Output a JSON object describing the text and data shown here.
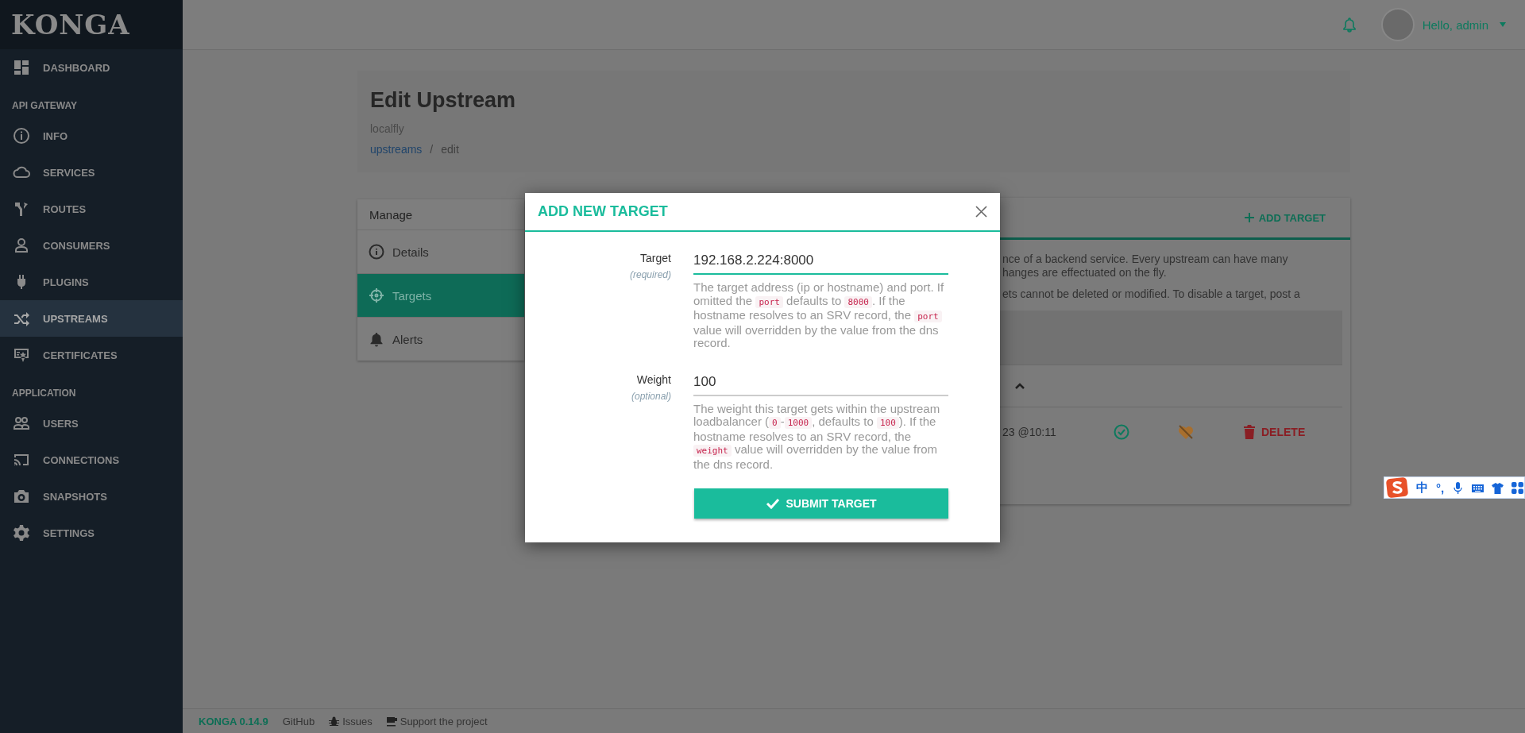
{
  "sidebar": {
    "logo": "KONGA",
    "groups": [
      {
        "items": [
          {
            "label": "DASHBOARD",
            "selected": false
          }
        ]
      },
      {
        "heading": "API GATEWAY",
        "items": [
          {
            "label": "INFO",
            "selected": false
          },
          {
            "label": "SERVICES",
            "selected": false
          },
          {
            "label": "ROUTES",
            "selected": false
          },
          {
            "label": "CONSUMERS",
            "selected": false
          },
          {
            "label": "PLUGINS",
            "selected": false
          },
          {
            "label": "UPSTREAMS",
            "selected": true
          },
          {
            "label": "CERTIFICATES",
            "selected": false
          }
        ]
      },
      {
        "heading": "APPLICATION",
        "items": [
          {
            "label": "USERS",
            "selected": false
          },
          {
            "label": "CONNECTIONS",
            "selected": false
          },
          {
            "label": "SNAPSHOTS",
            "selected": false
          },
          {
            "label": "SETTINGS",
            "selected": false
          }
        ]
      }
    ]
  },
  "topbar": {
    "greeting": "Hello, admin"
  },
  "page_header": {
    "title": "Edit Upstream",
    "subtitle": "localfly",
    "separator": "/",
    "breadcrumb": [
      {
        "label": "upstreams",
        "kind": "link"
      },
      {
        "label": "edit",
        "kind": "current"
      }
    ]
  },
  "manage_panel": {
    "title": "Manage",
    "items": [
      {
        "label": "Details",
        "selected": false
      },
      {
        "label": "Targets",
        "selected": true
      },
      {
        "label": "Alerts",
        "selected": false
      }
    ]
  },
  "targets_panel": {
    "add_button": "ADD TARGET",
    "description": [
      "nce of a backend service. Every upstream can have many",
      "hanges are effectuated on the fly.",
      "ets cannot be deleted or modified. To disable a target, post a"
    ],
    "row": {
      "created": "23 @10:11",
      "healthy": true,
      "delete_button": "DELETE"
    }
  },
  "modal": {
    "title": "ADD NEW TARGET",
    "fields": [
      {
        "label": "Target",
        "note": "(required)",
        "value": "192.168.2.224:8000",
        "focused": true,
        "help": [
          {
            "kind": "text",
            "text": "The target address (ip or hostname) and port. If omitted the "
          },
          {
            "kind": "code",
            "text": "port"
          },
          {
            "kind": "text",
            "text": " defaults to "
          },
          {
            "kind": "code",
            "text": "8000"
          },
          {
            "kind": "text",
            "text": ". If the hostname resolves to an SRV record, the "
          },
          {
            "kind": "code",
            "text": "port"
          },
          {
            "kind": "text",
            "text": " value will overridden by the value from the dns record."
          }
        ]
      },
      {
        "label": "Weight",
        "note": "(optional)",
        "value": "100",
        "focused": false,
        "help": [
          {
            "kind": "text",
            "text": "The weight this target gets within the upstream loadbalancer ("
          },
          {
            "kind": "code",
            "text": "0"
          },
          {
            "kind": "text",
            "text": "-"
          },
          {
            "kind": "code",
            "text": "1000"
          },
          {
            "kind": "text",
            "text": ", defaults to "
          },
          {
            "kind": "code",
            "text": "100"
          },
          {
            "kind": "text",
            "text": "). If the hostname resolves to an SRV record, the "
          },
          {
            "kind": "code",
            "text": "weight"
          },
          {
            "kind": "text",
            "text": " value will overridden by the value from the dns record."
          }
        ]
      }
    ],
    "submit_button": "SUBMIT TARGET"
  },
  "footer": {
    "items": [
      {
        "label": "KONGA 0.14.9",
        "kind": "version"
      },
      {
        "label": "GitHub",
        "kind": "link"
      },
      {
        "label": "Issues",
        "kind": "bug"
      },
      {
        "label": "Support the project",
        "kind": "coffee"
      }
    ]
  },
  "ime_toolbar": {
    "language": "中",
    "punctuation": "°,"
  }
}
